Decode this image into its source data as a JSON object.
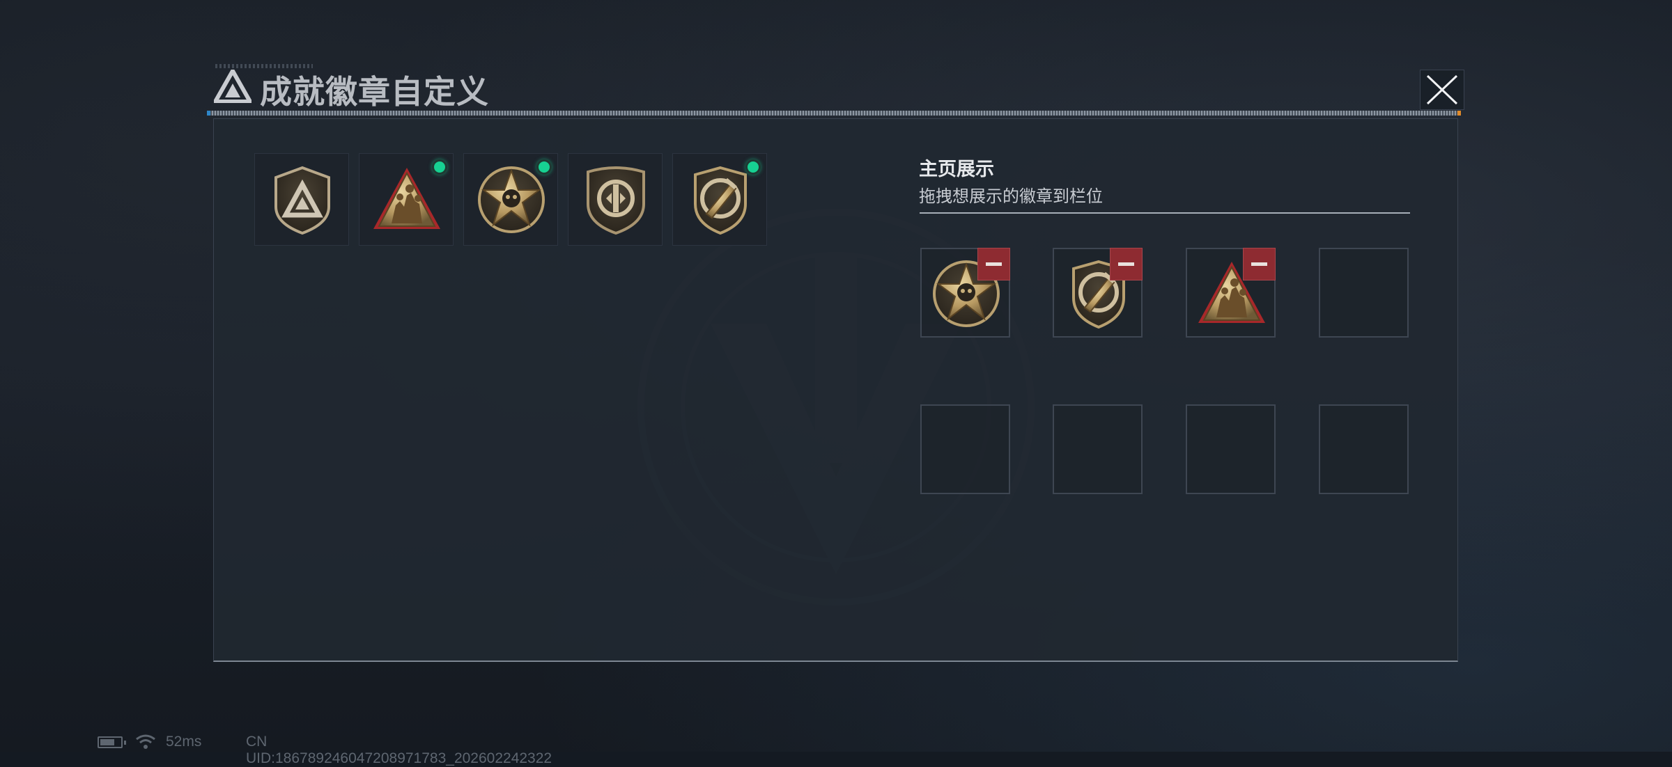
{
  "window": {
    "title": "成就徽章自定义"
  },
  "owned_badges": [
    {
      "icon": "triangle-shield-badge-icon",
      "is_new": false
    },
    {
      "icon": "soldiers-triangle-badge-icon",
      "is_new": true
    },
    {
      "icon": "skull-star-badge-icon",
      "is_new": true
    },
    {
      "icon": "emblem-shield-badge-icon",
      "is_new": false
    },
    {
      "icon": "dagger-shield-badge-icon",
      "is_new": true
    }
  ],
  "display": {
    "title": "主页展示",
    "hint": "拖拽想展示的徽章到栏位",
    "slots": [
      {
        "icon": "skull-star-badge-icon",
        "filled": true
      },
      {
        "icon": "dagger-shield-badge-icon",
        "filled": true
      },
      {
        "icon": "soldiers-triangle-badge-icon",
        "filled": true
      },
      {
        "icon": "",
        "filled": false
      },
      {
        "icon": "",
        "filled": false
      },
      {
        "icon": "",
        "filled": false
      },
      {
        "icon": "",
        "filled": false
      },
      {
        "icon": "",
        "filled": false
      }
    ]
  },
  "status": {
    "ping": "52ms",
    "uid": "CN UID:186789246047208971783_202602242322"
  },
  "colors": {
    "new_indicator": "#17d192",
    "remove_button": "#8e2b31",
    "badge_gold": "#c9b07a"
  }
}
